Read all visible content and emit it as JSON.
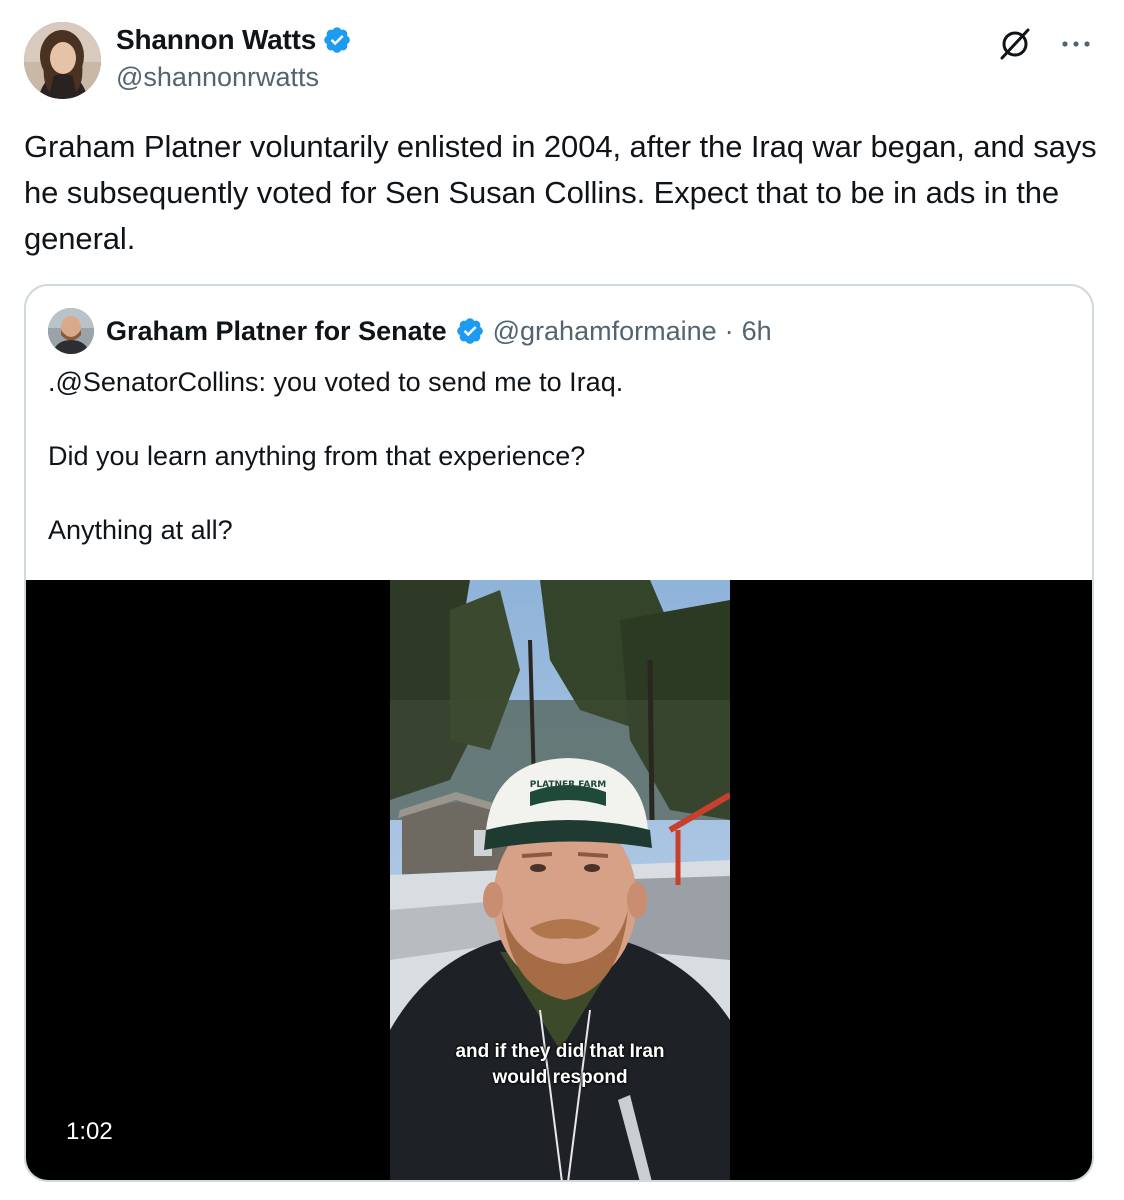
{
  "author": {
    "name": "Shannon Watts",
    "handle": "@shannonrwatts",
    "verified": true
  },
  "header_icons": [
    "grok-icon",
    "more-icon"
  ],
  "post_text": "Graham Platner voluntarily enlisted in 2004, after the Iraq war began, and says he subsequently voted for Sen Susan Collins. Expect that to be in ads in the general.",
  "quote": {
    "name": "Graham Platner for Senate",
    "handle": "@grahamformaine",
    "separator": "·",
    "time": "6h",
    "verified": true,
    "paragraphs": [
      ".@SenatorCollins: you voted to send me to Iraq.",
      "Did you learn anything from that experience?",
      "Anything at all?"
    ],
    "video": {
      "caption_line1": "and if they did that Iran",
      "caption_line2": "would respond",
      "cap_logo_text": "PLATNER FARM",
      "duration": "1:02"
    }
  },
  "colors": {
    "text": "#0f1419",
    "secondary": "#536471",
    "verified_blue": "#1d9bf0",
    "border": "#cfd9de"
  }
}
